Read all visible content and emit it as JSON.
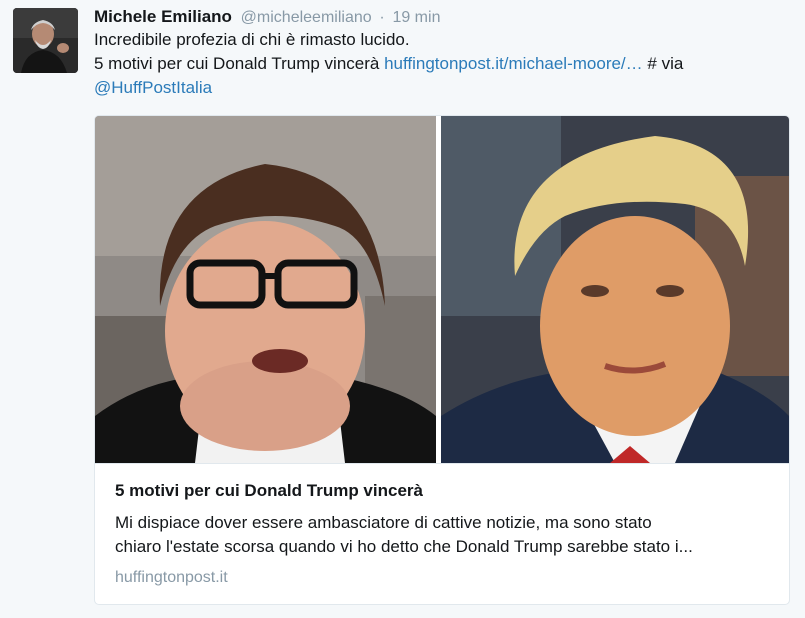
{
  "tweet": {
    "author": {
      "fullname": "Michele Emiliano",
      "username": "@micheleemiliano",
      "separator": "·",
      "time": "19 min"
    },
    "text": {
      "line1": "Incredibile profezia di chi è rimasto lucido.",
      "line2_prefix": "5 motivi per cui Donald Trump vincerà ",
      "line2_link": "huffingtonpost.it/michael-moore/…",
      "line2_suffix": " # via",
      "mention": "@HuffPostItalia"
    },
    "card": {
      "title": "5 motivi per cui Donald Trump vincerà",
      "description_line1": "Mi dispiace dover essere ambasciatore di cattive notizie, ma sono stato",
      "description_line2": "chiaro l'estate scorsa quando vi ho detto che Donald Trump sarebbe stato i...",
      "domain": "huffingtonpost.it"
    }
  },
  "colors": {
    "background": "#f5f8fa",
    "link": "#2b7bb9",
    "muted": "#8899a6",
    "border": "#e1e8ed"
  },
  "icons": {
    "avatar": "profile-photo",
    "card_image": "two-portrait-photos"
  }
}
